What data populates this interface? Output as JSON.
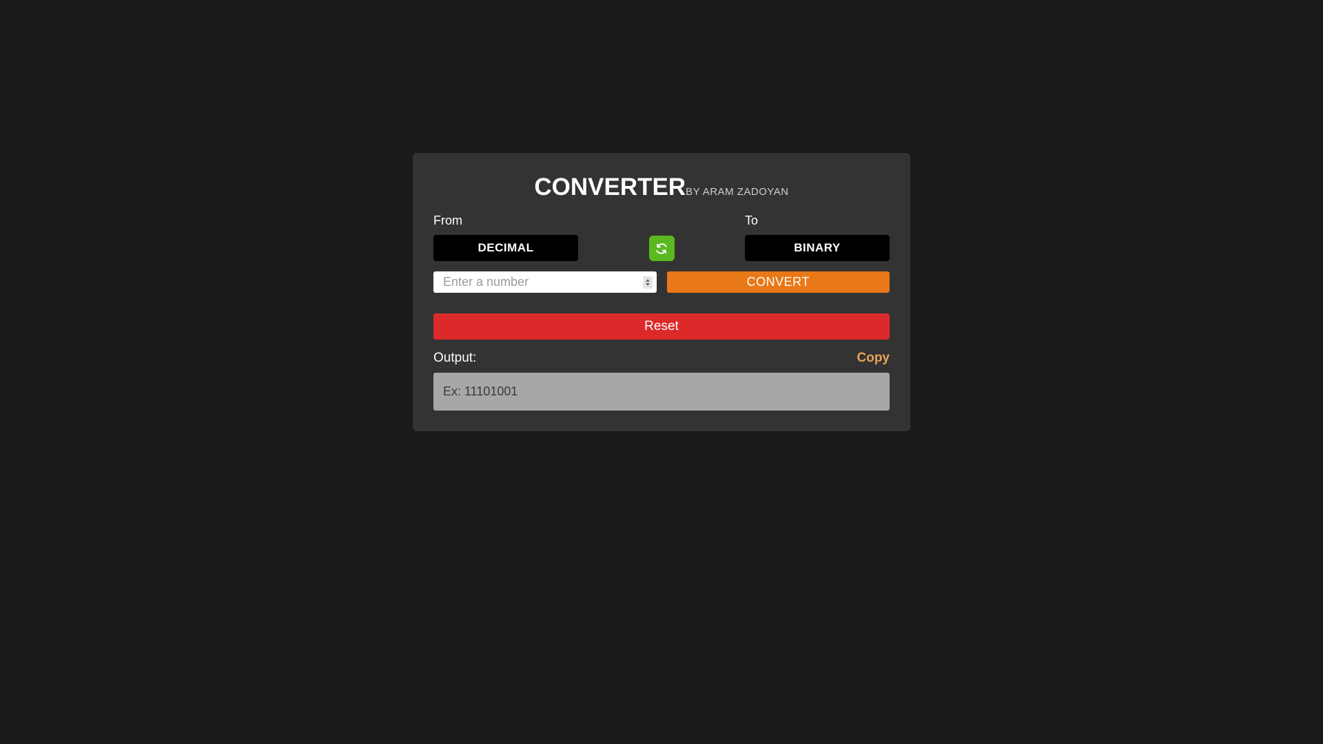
{
  "header": {
    "title": "CONVERTER",
    "subtitle": "BY ARAM ZADOYAN"
  },
  "conversion": {
    "from_label": "From",
    "from_value": "DECIMAL",
    "to_label": "To",
    "to_value": "BINARY"
  },
  "input": {
    "placeholder": "Enter a number",
    "value": ""
  },
  "buttons": {
    "convert": "CONVERT",
    "reset": "Reset"
  },
  "output": {
    "label": "Output:",
    "copy_label": "Copy",
    "placeholder": "Ex: 11101001"
  },
  "icons": {
    "swap": "swap-icon"
  }
}
